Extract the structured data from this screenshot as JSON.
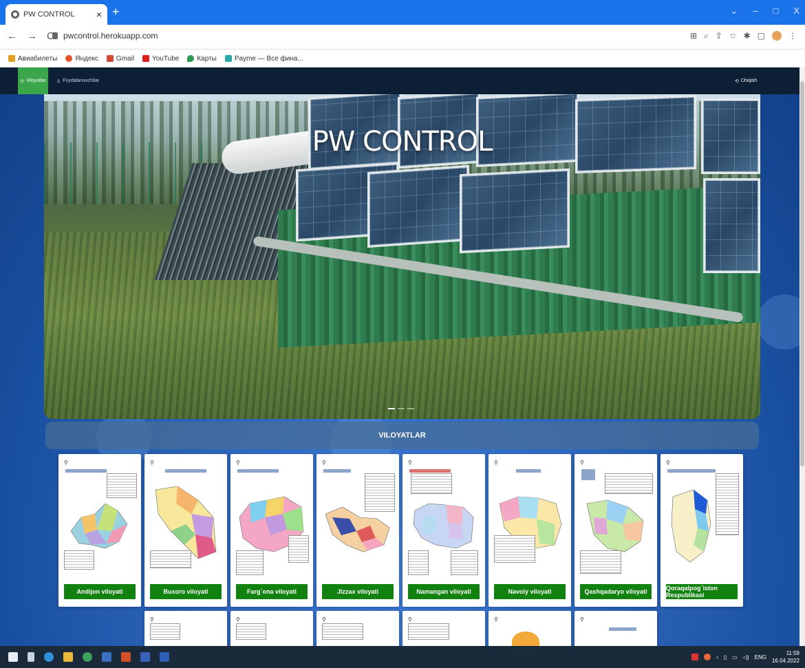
{
  "browser": {
    "tab_title": "PW CONTROL",
    "tab_close": "×",
    "new_tab": "+",
    "window_controls": [
      "⌄",
      "–",
      "□",
      "X"
    ],
    "url": "pwcontrol.herokuapp.com",
    "bookmarks": [
      {
        "label": "Авиабилеты",
        "color": "#e0a020"
      },
      {
        "label": "Яндекс",
        "color": "#e8502a"
      },
      {
        "label": "Gmail",
        "color": "#d44638"
      },
      {
        "label": "YouTube",
        "color": "#e02020"
      },
      {
        "label": "Карты",
        "color": "#2f9a55"
      },
      {
        "label": "Payme — Все фина...",
        "color": "#2aa8a8"
      }
    ]
  },
  "nav": {
    "active": "Viloyatlar",
    "users": "Foydalanuvchilar",
    "exit": "Chiqish"
  },
  "hero": {
    "title": "PW CONTROL"
  },
  "section": {
    "title": "VILOYATLAR"
  },
  "regions": [
    {
      "label": "Andijon viloyati"
    },
    {
      "label": "Buxoro viloyati"
    },
    {
      "label": "Farg`ona viloyati"
    },
    {
      "label": "Jizzax viloyati"
    },
    {
      "label": "Namangan viloyati"
    },
    {
      "label": "Navoiy viloyati"
    },
    {
      "label": "Qashqadaryo viloyati"
    },
    {
      "label": "Qoraqalpog`iston Respublikasi"
    }
  ],
  "taskbar": {
    "lang": "ENG",
    "time": "11:59",
    "date": "16.04.2022"
  },
  "colors": {
    "accent_green": "#11820f",
    "nav_active": "#3aa54a",
    "nav_bg": "#0c1f35",
    "browser_blue": "#1a73e8"
  }
}
